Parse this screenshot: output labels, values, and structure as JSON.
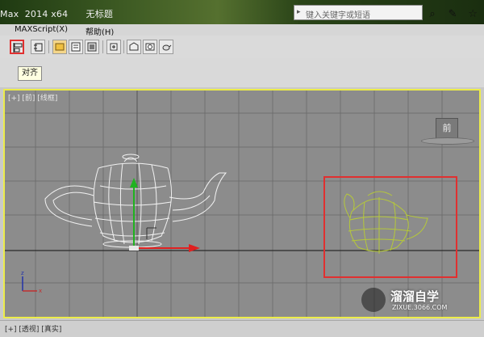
{
  "window": {
    "title": "Max  2014 x64      无标题"
  },
  "search": {
    "placeholder": "键入关键字或短语"
  },
  "menu": {
    "items": [
      "MAXScript(X)",
      "帮助(H)"
    ]
  },
  "toolbar": {
    "buttons": [
      "align-icon",
      "clone-align-icon",
      "layer-manager-icon",
      "scene-explorer-icon",
      "material-editor-icon",
      "render-setup-icon",
      "rendered-frame-icon",
      "render-icon",
      "teapot-render-icon"
    ],
    "tooltip": "对齐",
    "highlight_color": "#e03030"
  },
  "viewport": {
    "label": "[+] [前] [线框]",
    "border_color": "#ecec4a",
    "viewcube_label": "前"
  },
  "status": {
    "label": "[+] [透视] [真实]"
  },
  "watermark": {
    "title": "溜溜自学",
    "subtitle": "ZIXUE.3066.COM"
  },
  "colors": {
    "teapot_white": "#f2f2f2",
    "teapot_green": "#b5c83a",
    "selection_box": "#e03030",
    "gizmo_y": "#1fb31f",
    "gizmo_x": "#e02020"
  }
}
